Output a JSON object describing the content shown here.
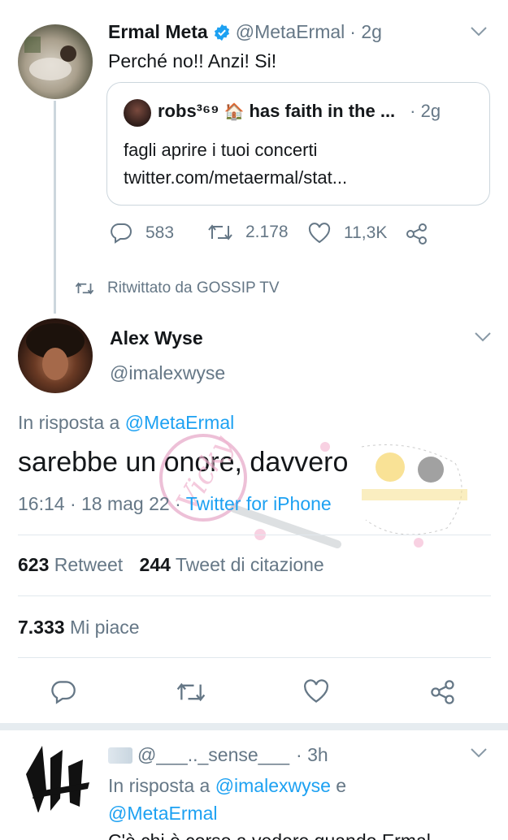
{
  "tweet1": {
    "name": "Ermal Meta",
    "handle": "@MetaErmal",
    "time": "· 2g",
    "text": "Perché no!! Anzi! Si!",
    "quote": {
      "name": "robs³⁶⁹",
      "emoji": "🏠",
      "name_rest": "has faith in the ...",
      "time": "· 2g",
      "line1": "fagli aprire i tuoi concerti",
      "line2": "twitter.com/metaermal/stat..."
    },
    "replies": "583",
    "retweets": "2.178",
    "likes": "11,3K"
  },
  "retweeted_by": "Ritwittato da GOSSIP TV",
  "tweet2": {
    "name": "Alex Wyse",
    "handle": "@imalexwyse",
    "reply_prefix": "In risposta a ",
    "reply_to": "@MetaErmal",
    "text": "sarebbe un onore, davvero",
    "meta_time": "16:14 · 18 mag 22 · ",
    "meta_source": "Twitter for iPhone",
    "retweet_count": "623",
    "retweet_label": "Retweet",
    "quote_count": "244",
    "quote_label": "Tweet di citazione",
    "like_count": "7.333",
    "like_label": "Mi piace"
  },
  "tweet3": {
    "handle": "@___.._sense___",
    "time": "· 3h",
    "reply_prefix": "In risposta a ",
    "reply_to1": "@imalexwyse",
    "reply_and": " e",
    "reply_to2": "@MetaErmal",
    "text_partial": "C'è chi è corso a vedere quando Ermal"
  },
  "colors": {
    "accent": "#1da1f2",
    "muted": "#657786",
    "border": "#ccd6dd",
    "verified": "#1da1f2"
  }
}
